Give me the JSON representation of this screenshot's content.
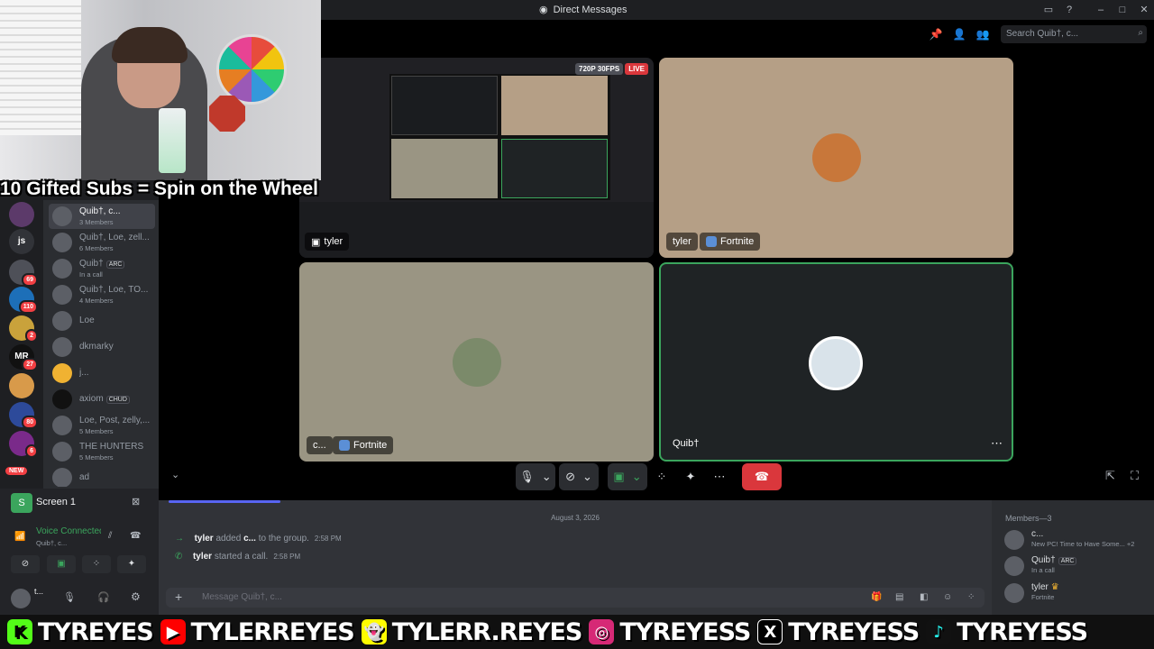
{
  "window": {
    "title": "Direct Messages"
  },
  "search": {
    "placeholder": "Search Quib†, c..."
  },
  "stream_caption": "10 Gifted Subs = Spin on the Wheel",
  "tiles": [
    {
      "name": "tyler",
      "badge_res": "720P 30FPS",
      "badge_live": "LIVE"
    },
    {
      "name": "tyler",
      "game": "Fortnite"
    },
    {
      "name": "c...",
      "game": "Fortnite"
    },
    {
      "name": "Quib†"
    }
  ],
  "guilds": [
    {
      "label": "js"
    },
    {
      "badge": "69"
    },
    {
      "badge": "110"
    },
    {
      "badge": "2"
    },
    {
      "label": "MR",
      "badge": "27"
    },
    {
      "badge": "80"
    },
    {
      "badge": "6"
    },
    {
      "label": "NEW"
    }
  ],
  "dms": [
    {
      "name": "Quib†, c...",
      "sub": "3 Members"
    },
    {
      "name": "Quib†, Loe, zell...",
      "sub": "6 Members"
    },
    {
      "name": "Quib†",
      "tag": "ARC",
      "sub": "In a call"
    },
    {
      "name": "Quib†, Loe, TO...",
      "sub": "4 Members"
    },
    {
      "name": "Loe"
    },
    {
      "name": "dkmarky"
    },
    {
      "name": "j..."
    },
    {
      "name": "axiom",
      "tag": "CHUD"
    },
    {
      "name": "Loe, Post, zelly,...",
      "sub": "5 Members"
    },
    {
      "name": "THE HUNTERS",
      "sub": "5 Members"
    },
    {
      "name": "ad"
    }
  ],
  "screen_panel": {
    "title": "Screen 1",
    "voice_status": "Voice Connected",
    "voice_channel": "Quib†, c...",
    "user": "t..."
  },
  "chat": {
    "date": "August 3, 2026",
    "messages": [
      {
        "user": "tyler",
        "text_a": "added",
        "target": "c...",
        "text_b": "to the group.",
        "time": "2:58 PM"
      },
      {
        "user": "tyler",
        "text_a": "started a call.",
        "time": "2:58 PM"
      }
    ],
    "composer_placeholder": "Message Quib†, c..."
  },
  "members": {
    "header": "Members—3",
    "list": [
      {
        "name": "c...",
        "sub": "New PC! Time to Have Some...",
        "extra": "+2"
      },
      {
        "name": "Quib†",
        "tag": "ARC",
        "sub": "In a call"
      },
      {
        "name": "tyler",
        "sub": "Fortnite"
      }
    ]
  },
  "socials": [
    {
      "icon": "K",
      "handle": "TYREYES",
      "color": "#53fc18"
    },
    {
      "icon": "▶",
      "handle": "TYLERREYES",
      "color": "#ff0000"
    },
    {
      "icon": "👻",
      "handle": "TYLERR.REYES",
      "color": "#fffc00"
    },
    {
      "icon": "◎",
      "handle": "TYREYESS",
      "color": "#d62976"
    },
    {
      "icon": "X",
      "handle": "TYREYESS",
      "color": "#000000"
    },
    {
      "icon": "♪",
      "handle": "TYREYESS",
      "color": "#111111"
    }
  ]
}
